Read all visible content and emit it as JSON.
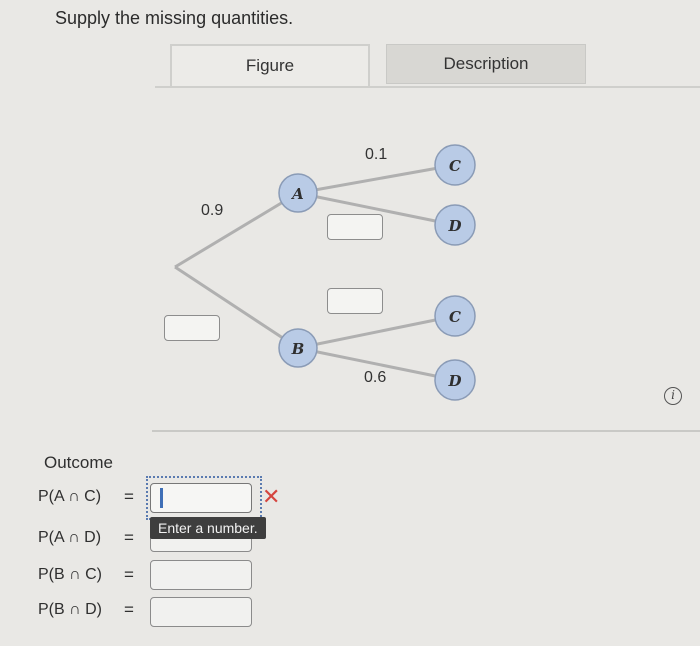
{
  "prompt": "Supply the missing quantities.",
  "tabs": [
    {
      "label": "Figure"
    },
    {
      "label": "Description"
    }
  ],
  "tree": {
    "first_branch_labels": {
      "A": "0.9"
    },
    "second_branch_labels": {
      "A_C": "0.1",
      "B_D": "0.6"
    },
    "nodes": {
      "A": "A",
      "B": "B",
      "C1": "C",
      "D1": "D",
      "C2": "C",
      "D2": "D"
    },
    "colors": {
      "node_fill": "#b9cbe6",
      "node_stroke": "#8a9bb6",
      "branch": "#b0b0b0"
    }
  },
  "info_icon": {
    "glyph": "i"
  },
  "outcome": {
    "title": "Outcome",
    "rows": [
      {
        "label": "P(A ∩ C)",
        "eq": "="
      },
      {
        "label": "P(A ∩ D)",
        "eq": "="
      },
      {
        "label": "P(B ∩ C)",
        "eq": "="
      },
      {
        "label": "P(B ∩ D)",
        "eq": "="
      }
    ],
    "error_mark": "✕",
    "tooltip": "Enter a number."
  }
}
